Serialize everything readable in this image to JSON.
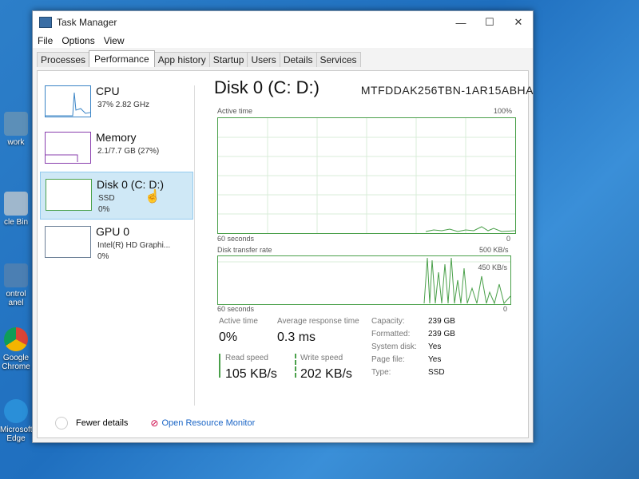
{
  "window": {
    "title": "Task Manager",
    "controls": [
      "—",
      "☐",
      "✕"
    ]
  },
  "menu": [
    "File",
    "Options",
    "View"
  ],
  "tabs": [
    "Processes",
    "Performance",
    "App history",
    "Startup",
    "Users",
    "Details",
    "Services"
  ],
  "active_tab": "Performance",
  "sidebar": [
    {
      "name": "CPU",
      "sub1": "37% 2.82 GHz",
      "sub2": ""
    },
    {
      "name": "Memory",
      "sub1": "2.1/7.7 GB (27%)",
      "sub2": ""
    },
    {
      "name": "Disk 0 (C: D:)",
      "sub1": "SSD",
      "sub2": "0%"
    },
    {
      "name": "GPU 0",
      "sub1": "Intel(R) HD Graphi...",
      "sub2": "0%"
    }
  ],
  "main": {
    "title": "Disk 0 (C: D:)",
    "model": "MTFDDAK256TBN-1AR15ABHA",
    "active_time_label": "Active time",
    "active_time_max": "100%",
    "seconds_label": "60 seconds",
    "zero_label": "0",
    "transfer_label": "Disk transfer rate",
    "transfer_max": "500 KB/s",
    "transfer_mid": "450 KB/s"
  },
  "stats": {
    "active_time_label": "Active time",
    "active_time_value": "0%",
    "avg_response_label": "Average response time",
    "avg_response_value": "0.3 ms",
    "read_label": "Read speed",
    "read_value": "105 KB/s",
    "write_label": "Write speed",
    "write_value": "202 KB/s",
    "capacity_label": "Capacity:",
    "capacity_value": "239 GB",
    "formatted_label": "Formatted:",
    "formatted_value": "239 GB",
    "system_disk_label": "System disk:",
    "system_disk_value": "Yes",
    "page_file_label": "Page file:",
    "page_file_value": "Yes",
    "type_label": "Type:",
    "type_value": "SSD"
  },
  "footer": {
    "fewer_details": "Fewer details",
    "resource_monitor": "Open Resource Monitor"
  },
  "desktop_icons": [
    "work",
    "cle Bin",
    "ontrol\nanel",
    "Google\nChrome",
    "Microsoft\nEdge"
  ],
  "colors": {
    "disk_green": "#4aa04a",
    "cpu_blue": "#3a84c6",
    "mem_purple": "#8a3fae",
    "accent_link": "#1a65c6"
  }
}
